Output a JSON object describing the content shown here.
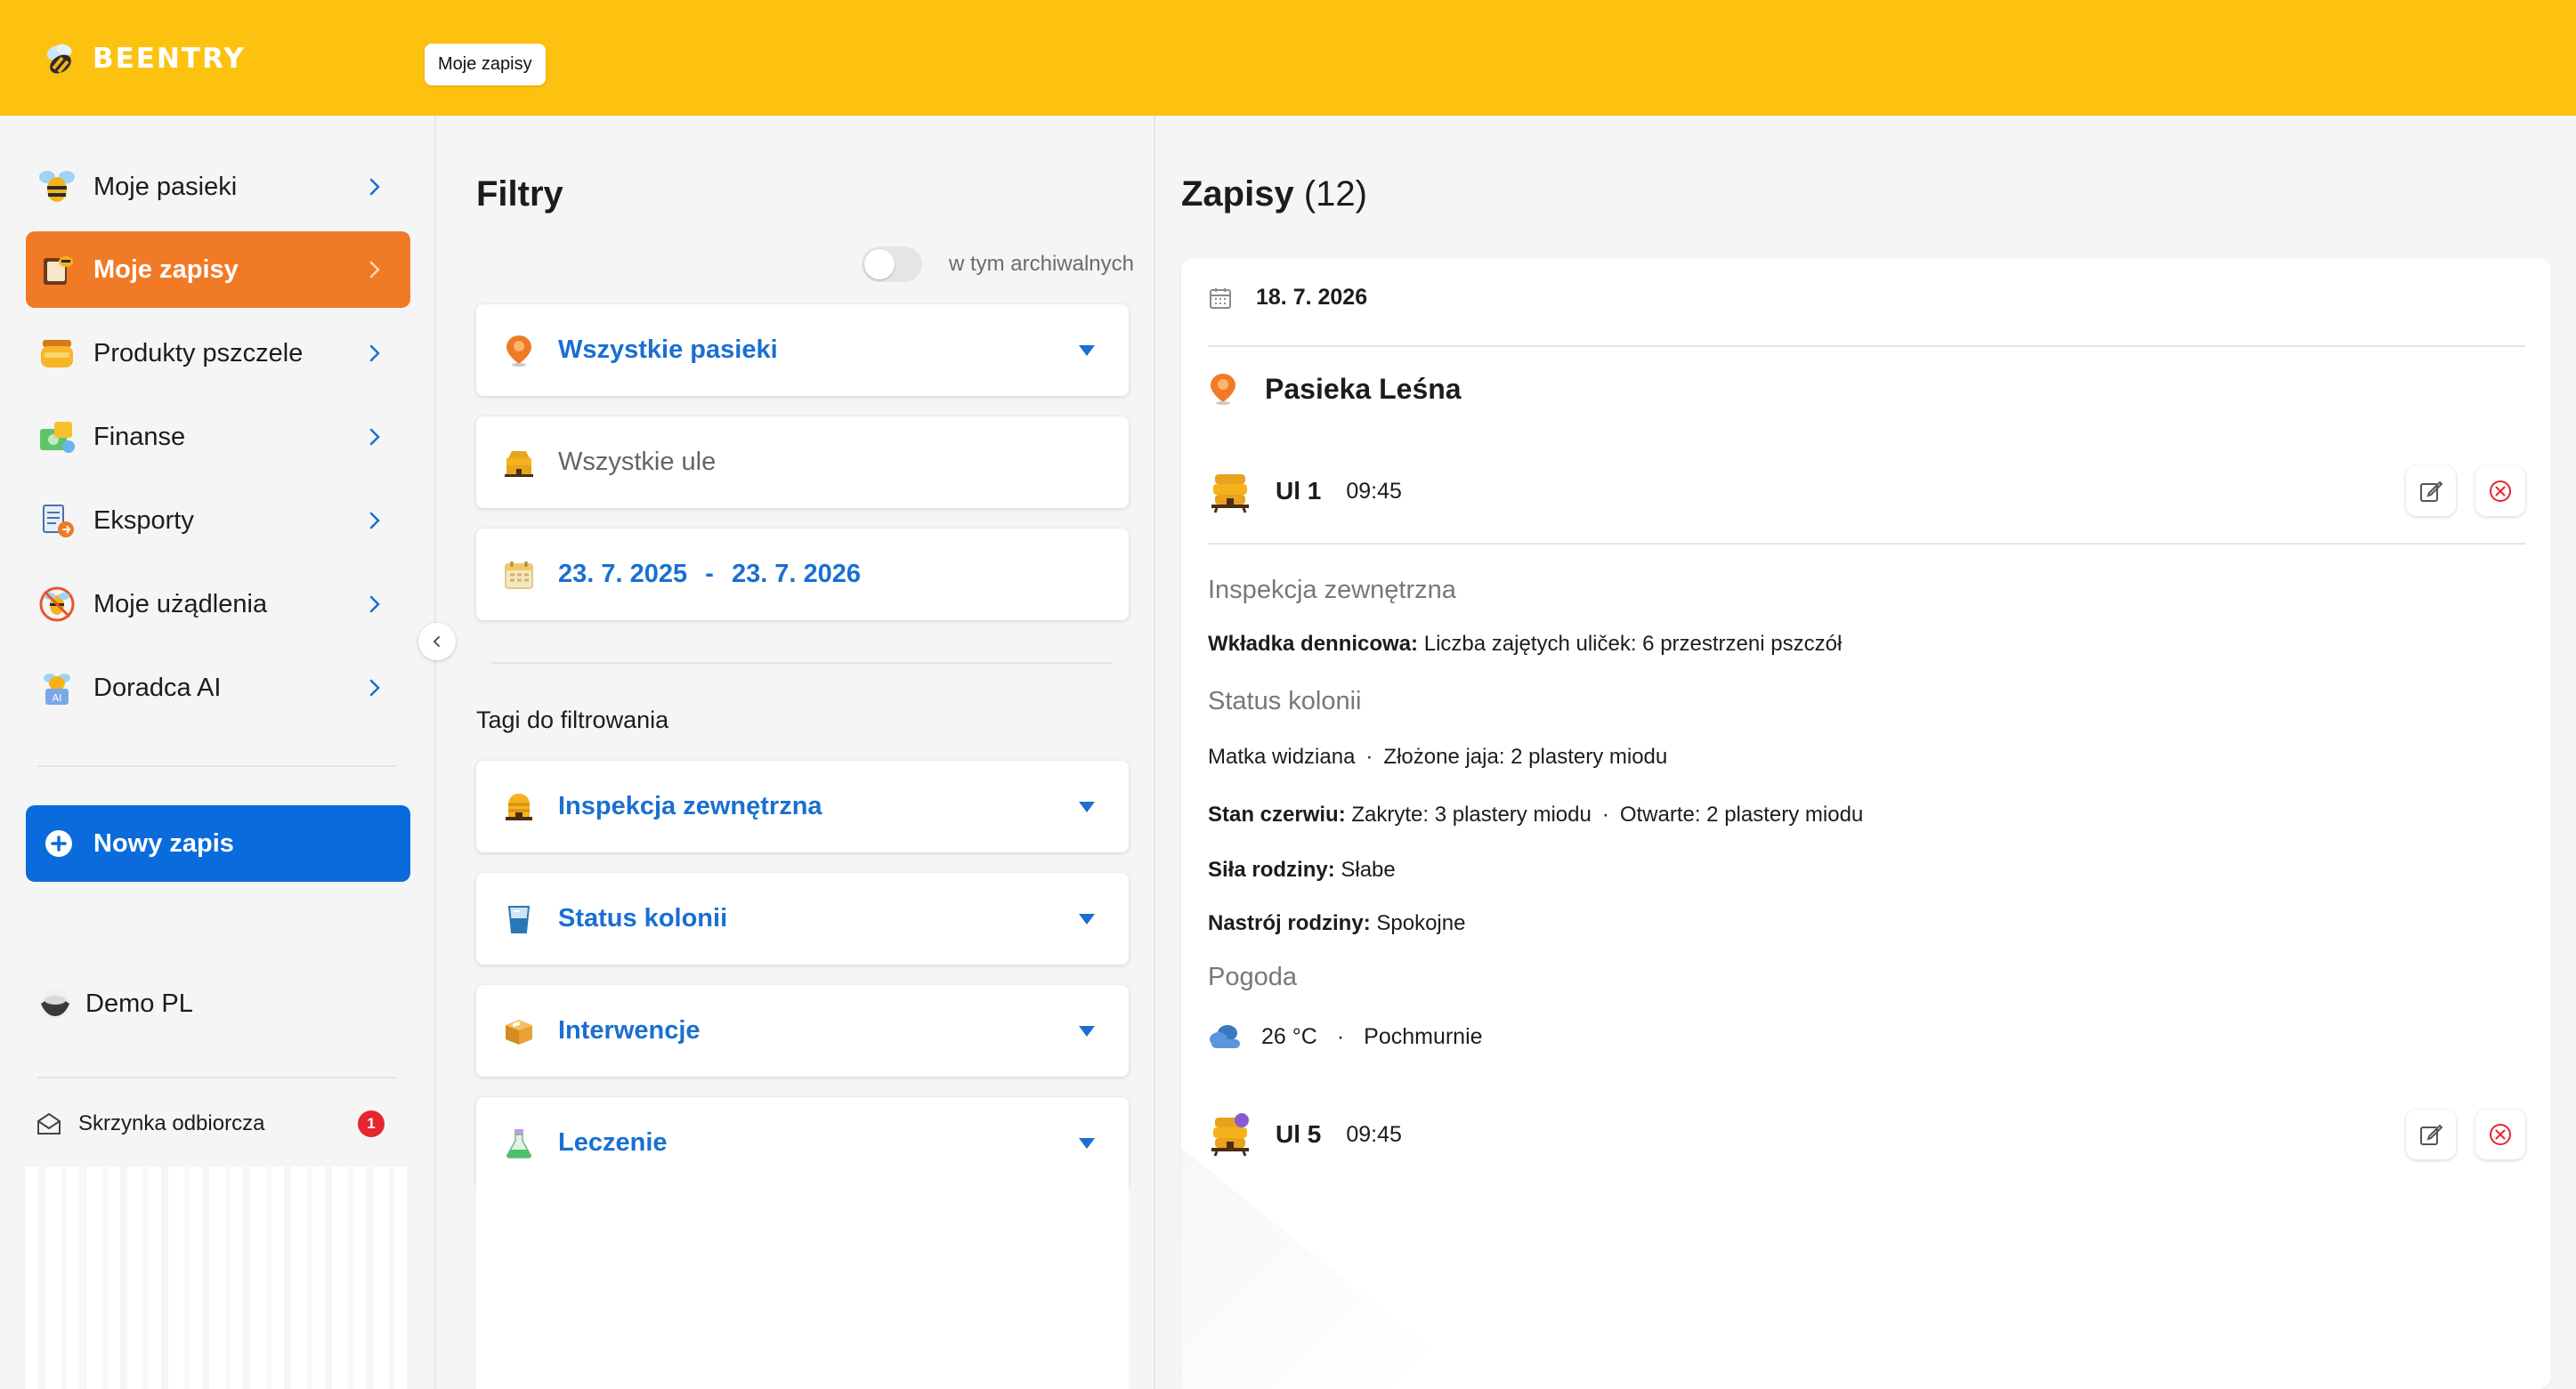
{
  "app": {
    "logo_text": "BEENTRY",
    "breadcrumb": "Moje zapisy"
  },
  "sidebar": {
    "items": [
      {
        "label": "Moje pasieki",
        "icon": "bee-icon",
        "active": false
      },
      {
        "label": "Moje zapisy",
        "icon": "notebook-icon",
        "active": true
      },
      {
        "label": "Produkty pszczele",
        "icon": "honey-jar-icon",
        "active": false
      },
      {
        "label": "Finanse",
        "icon": "money-icon",
        "active": false
      },
      {
        "label": "Eksporty",
        "icon": "export-icon",
        "active": false
      },
      {
        "label": "Moje użądlenia",
        "icon": "sting-icon",
        "active": false
      },
      {
        "label": "Doradca AI",
        "icon": "ai-advisor-icon",
        "active": false
      }
    ],
    "new_entry_label": "Nowy zapis",
    "user_name": "Demo PL",
    "inbox_label": "Skrzynka odbiorcza",
    "inbox_count": "1"
  },
  "filters": {
    "title": "Filtry",
    "archived_label": "w tym archiwalnych",
    "archived_on": false,
    "apiary_select": "Wszystkie pasieki",
    "hive_select": "Wszystkie ule",
    "date_from": "23. 7. 2025",
    "date_sep": "-",
    "date_to": "23. 7. 2026",
    "tags_title": "Tagi do filtrowania",
    "tags": [
      {
        "label": "Inspekcja zewnętrzna",
        "icon": "hive-icon"
      },
      {
        "label": "Status kolonii",
        "icon": "beaker-icon"
      },
      {
        "label": "Interwencje",
        "icon": "box-icon"
      },
      {
        "label": "Leczenie",
        "icon": "flask-icon"
      }
    ]
  },
  "entries": {
    "title": "Zapisy",
    "count": "(12)",
    "date": "18. 7. 2026",
    "apiary": "Pasieka Leśna",
    "hive1": {
      "name": "Ul 1",
      "time": "09:45"
    },
    "inspection_title": "Inspekcja zewnętrzna",
    "bottom_board_label": "Wkładka dennicowa:",
    "bottom_board_value": "Liczba zajętych uliček: 6 przestrzeni pszczół",
    "colony_title": "Status kolonii",
    "queen_seen": "Matka widziana",
    "eggs": "Złożone jaja: 2 plastery miodu",
    "brood_label": "Stan czerwiu:",
    "brood_capped": "Zakryte: 3 plastery miodu",
    "brood_open": "Otwarte: 2 plastery miodu",
    "strength_label": "Siła rodziny:",
    "strength_value": "Słabe",
    "mood_label": "Nastrój rodziny:",
    "mood_value": "Spokojne",
    "weather_title": "Pogoda",
    "temperature": "26 °C",
    "weather_desc": "Pochmurnie",
    "hive2": {
      "name": "Ul 5",
      "time": "09:45"
    }
  },
  "colors": {
    "topbar": "#fdc20f",
    "active": "#f07a26",
    "primary": "#0a6bdc",
    "link": "#1a6fd1"
  }
}
